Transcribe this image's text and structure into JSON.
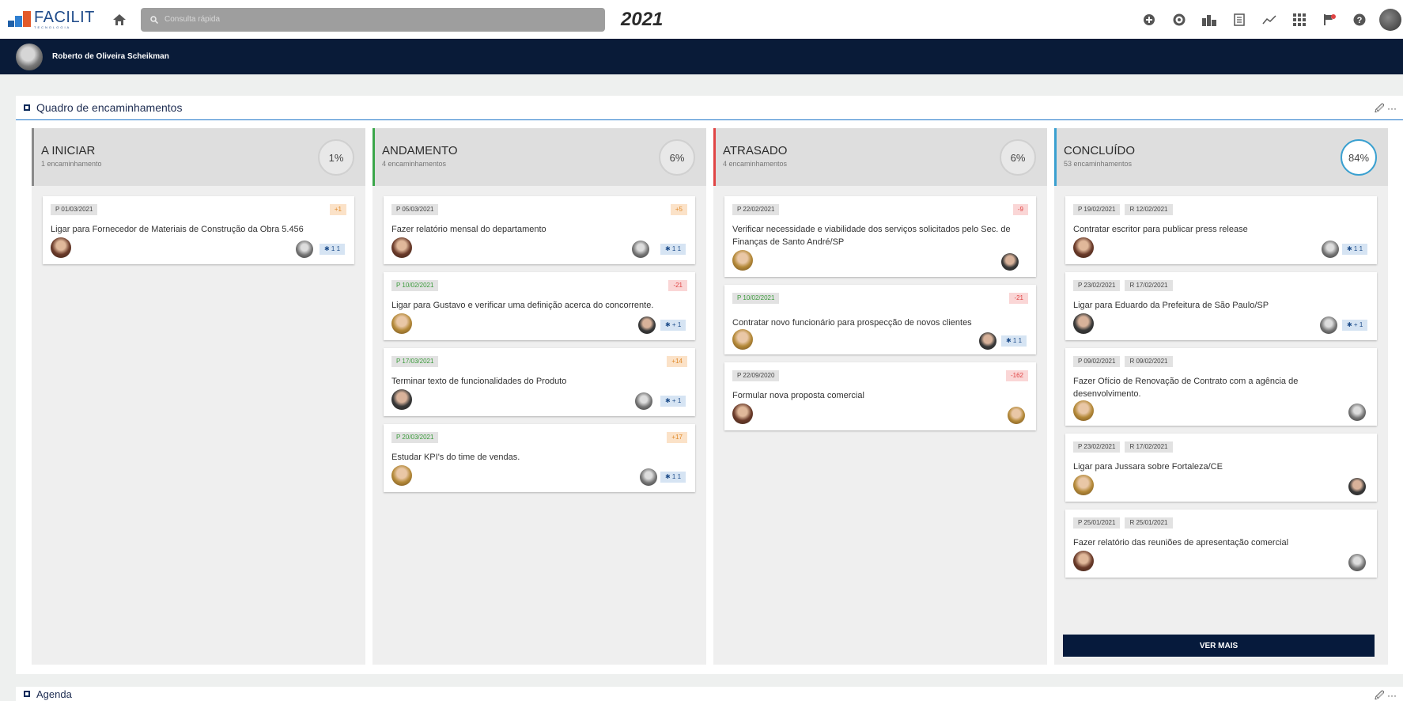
{
  "app": {
    "brand": "FACILIT",
    "brand_sub": "TECNOLOGIA",
    "search_placeholder": "Consulta rápida",
    "year": "2021",
    "user_name": "Roberto de Oliveira Scheikman"
  },
  "board": {
    "title": "Quadro de encaminhamentos",
    "actions": "🖉 ···",
    "ver_mais": "VER MAIS",
    "columns": [
      {
        "title": "A INICIAR",
        "subtitle": "1 encaminhamento",
        "percent": "1%",
        "accent": "#8a8a8a",
        "cards": [
          {
            "dates": [
              "P 01/03/2021"
            ],
            "status": "+1",
            "text": "Ligar para Fornecedor de Materiais de Construção da Obra 5.456",
            "count": "✱ 1 1"
          }
        ]
      },
      {
        "title": "ANDAMENTO",
        "subtitle": "4 encaminhamentos",
        "percent": "6%",
        "accent": "#3aa64a",
        "cards": [
          {
            "dates": [
              "P 05/03/2021"
            ],
            "status": "+5",
            "text": "Fazer relatório mensal do departamento",
            "count": "✱ 1 1"
          },
          {
            "dates": [
              "P 10/02/2021"
            ],
            "status": "-21",
            "text": "Ligar para Gustavo e verificar uma definição acerca do concorrente.",
            "count": "✱ + 1"
          },
          {
            "dates": [
              "P 17/03/2021"
            ],
            "status": "+14",
            "text": "Terminar texto de funcionalidades do Produto",
            "count": "✱ + 1"
          },
          {
            "dates": [
              "P 20/03/2021"
            ],
            "status": "+17",
            "text": "Estudar KPI's do time de vendas.",
            "count": "✱ 1 1"
          }
        ]
      },
      {
        "title": "ATRASADO",
        "subtitle": "4 encaminhamentos",
        "percent": "6%",
        "accent": "#e04444",
        "cards": [
          {
            "dates": [
              "P 22/02/2021"
            ],
            "status": "-9",
            "text": "Verificar necessidade e viabilidade dos serviços solicitados pelo Sec. de Finanças de Santo André/SP",
            "count": ""
          },
          {
            "dates": [
              "P 10/02/2021"
            ],
            "status": "-21",
            "text": "Contratar novo funcionário para prospecção de novos clientes",
            "count": "✱ 1 1"
          },
          {
            "dates": [
              "P 22/09/2020"
            ],
            "status": "-162",
            "text": "Formular nova proposta comercial",
            "count": ""
          }
        ]
      },
      {
        "title": "CONCLUÍDO",
        "subtitle": "53 encaminhamentos",
        "percent": "84%",
        "accent": "#3aa0d0",
        "cards": [
          {
            "dates": [
              "P 19/02/2021",
              "R 12/02/2021"
            ],
            "status": "",
            "text": "Contratar escritor para publicar press release",
            "count": "✱ 1 1"
          },
          {
            "dates": [
              "P 23/02/2021",
              "R 17/02/2021"
            ],
            "status": "",
            "text": "Ligar para Eduardo da Prefeitura de São Paulo/SP",
            "count": "✱ + 1"
          },
          {
            "dates": [
              "P 09/02/2021",
              "R 09/02/2021"
            ],
            "status": "",
            "text": "Fazer Ofício de Renovação de Contrato com a agência de desenvolvimento.",
            "count": ""
          },
          {
            "dates": [
              "P 23/02/2021",
              "R 17/02/2021"
            ],
            "status": "",
            "text": "Ligar para Jussara sobre Fortaleza/CE",
            "count": ""
          },
          {
            "dates": [
              "P 25/01/2021",
              "R 25/01/2021"
            ],
            "status": "",
            "text": "Fazer relatório das reuniões de apresentação comercial",
            "count": ""
          }
        ]
      }
    ]
  },
  "agenda": {
    "title": "Agenda"
  }
}
